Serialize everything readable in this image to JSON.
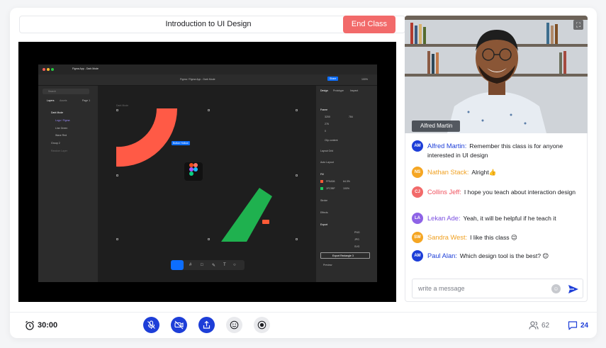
{
  "class_title": "Introduction to UI Design",
  "end_class_label": "End Class",
  "shared_screen": {
    "app_tab": "Figma App - Dark Mode",
    "breadcrumb": "Figma / Figma App - Dark Mode",
    "share_label": "Share",
    "zoom": "100%",
    "search_placeholder": "Search",
    "layers_tab": "Layers",
    "assets_tab": "Assets",
    "page_label": "Page 1",
    "layers": [
      "Dark Mode",
      "Logo / Figma",
      "Line Green",
      "Wave Red",
      "Group 2",
      "Random Layer"
    ],
    "canvas_frame_label": "Dark Mode",
    "selection_tag": "Button Hollow",
    "right_tabs": [
      "Design",
      "Prototype",
      "Inspect"
    ],
    "section_frame": "Frame",
    "frame_values": [
      "3200",
      "784",
      "276",
      "0"
    ],
    "clip_content": "Clip content",
    "section_layout_grid": "Layout Grid",
    "section_auto_layout": "Auto Layout",
    "section_fill": "Fill",
    "fills": [
      {
        "hex": "FF5A36",
        "opacity": "64.3%",
        "color": "#ff5a36"
      },
      {
        "hex": "1FC95F",
        "opacity": "100%",
        "color": "#1fc95f"
      }
    ],
    "section_stroke": "Stroke",
    "section_effects": "Effects",
    "section_export": "Export",
    "export_formats": [
      "PNG",
      "JPG",
      "SVG"
    ],
    "export_button": "Export Rectangle 3",
    "preview_label": "Preview"
  },
  "video": {
    "participant_name": "Alfred Martin",
    "fullscreen_icon": "fullscreen-icon"
  },
  "chat": {
    "messages": [
      {
        "initials": "AM",
        "name": "Alfred Martin:",
        "text": "Remember this class is for anyone interested in UI design",
        "color": "#1d3ed8",
        "avatar_color": "#1d3ed8"
      },
      {
        "initials": "NS",
        "name": "Nathan Stack:",
        "text": "Alright👍",
        "color": "#f0a020",
        "avatar_color": "#f5a623"
      },
      {
        "initials": "CJ",
        "name": "Collins Jeff:",
        "text": "I hope you teach about interaction design",
        "color": "#f0525e",
        "avatar_color": "#f26a6a"
      },
      {
        "initials": "LA",
        "name": "Lekan Ade:",
        "text": "Yeah, it will be helpful if he teach it",
        "color": "#7b4fe0",
        "avatar_color": "#8e63e6"
      },
      {
        "initials": "SW",
        "name": "Sandra West:",
        "text": "I like this class 😉",
        "color": "#f0a020",
        "avatar_color": "#f5a623"
      },
      {
        "initials": "AM",
        "name": "Paul Alan:",
        "text": "Which design tool is the best? 😊",
        "color": "#1d3ed8",
        "avatar_color": "#1d3ed8"
      }
    ],
    "input_placeholder": "write a message"
  },
  "footer": {
    "timer": "30:00",
    "participants_count": "62",
    "messages_count": "24"
  },
  "colors": {
    "accent": "#1d3ed8",
    "end_class": "#f26a6a"
  }
}
